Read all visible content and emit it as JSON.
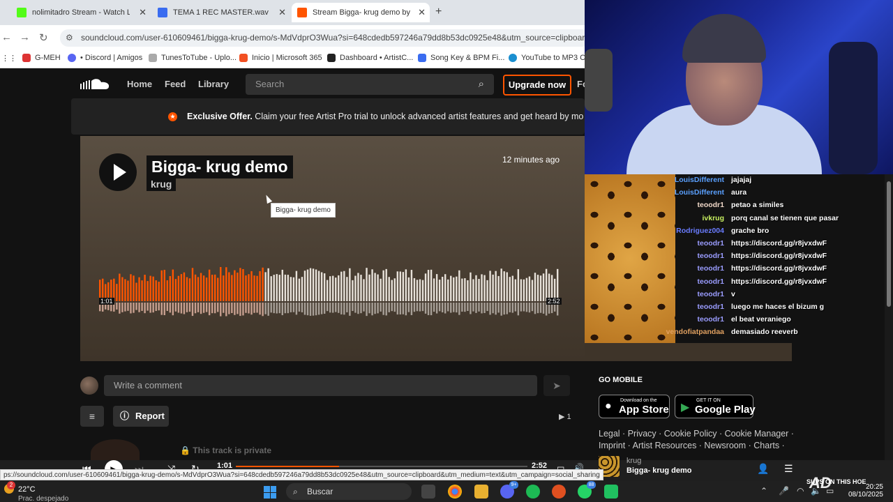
{
  "browser": {
    "tabs": [
      {
        "title": "nolimitadro Stream - Watch Liv",
        "color": "#53fc18"
      },
      {
        "title": "TEMA 1 REC MASTER.wav",
        "color": "#3a6cf0"
      },
      {
        "title": "Stream Bigga- krug demo by k",
        "color": "#ff5500"
      }
    ],
    "url": "soundcloud.com/user-610609461/bigga-krug-demo/s-MdVdprO3Wua?si=648cdedb597246a79dd8b53dc0925e48&utm_source=clipboard",
    "bookmarks": [
      {
        "label": "G-MEH",
        "color": "#d33"
      },
      {
        "label": "• Discord | Amigos",
        "color": "#5865f2"
      },
      {
        "label": "TunesToTube - Uplo...",
        "color": "#aaa"
      },
      {
        "label": "Inicio | Microsoft 365",
        "color": "#f25022"
      },
      {
        "label": "Dashboard • ArtistC...",
        "color": "#222"
      },
      {
        "label": "Song Key & BPM Fi...",
        "color": "#3a6cf0"
      },
      {
        "label": "YouTube to MP3 Co",
        "color": "#1a8fd0"
      }
    ]
  },
  "header": {
    "nav": [
      "Home",
      "Feed",
      "Library"
    ],
    "search_placeholder": "Search",
    "upgrade_label": "Upgrade now",
    "cut_link": "Fo"
  },
  "offer": {
    "bold": "Exclusive Offer.",
    "text": " Claim your free Artist Pro trial to unlock advanced artist features and get heard by mo"
  },
  "track": {
    "title": "Bigga- krug demo",
    "artist": "krug",
    "uploaded": "12 minutes ago",
    "tooltip": "Bigga- krug demo",
    "current_time": "1:01",
    "duration": "2:52",
    "played_fraction": 0.355
  },
  "comments": {
    "placeholder": "Write a comment",
    "report_label": "Report",
    "plays": "1",
    "private_notice": "This track is private"
  },
  "sidebar": {
    "go_mobile": "GO MOBILE",
    "app_store_small": "Download on the",
    "app_store_big": "App Store",
    "google_small": "GET IT ON",
    "google_big": "Google Play",
    "footer_line1": "Legal · Privacy · Cookie Policy · Cookie Manager ·",
    "footer_line2": "Imprint · Artist Resources · Newsroom · Charts ·"
  },
  "player": {
    "time_current": "1:01",
    "time_total": "2:52",
    "now_playing_artist": "krug",
    "now_playing_title": "Bigga- krug demo"
  },
  "status_url": "ps://soundcloud.com/user-610609461/bigga-krug-demo/s-MdVdprO3Wua?si=648cdedb597246a79dd8b53dc0925e48&utm_source=clipboard&utm_medium=text&utm_campaign=social_sharing",
  "taskbar": {
    "temp": "22°C",
    "weather": "Prac. despejado",
    "weather_badge": "2",
    "search": "Buscar",
    "badge_discord": "9+",
    "badge_whatsapp": "88",
    "time": "20:25",
    "date": "08/10/2025"
  },
  "chat": [
    {
      "user": "LouisDifferent",
      "msg": "jajajaj",
      "color": "#5aa0ff"
    },
    {
      "user": "LouisDifferent",
      "msg": "aura",
      "color": "#5aa0ff"
    },
    {
      "user": "teoodr1",
      "msg": "petao a similes",
      "color": "#f0d8c8"
    },
    {
      "user": "ivkrug",
      "msg": "porq canal se tienen que pasar",
      "color": "#c8f060"
    },
    {
      "user": "Rodriguez004",
      "msg": "grache bro",
      "color": "#6a7cff"
    },
    {
      "user": "teoodr1",
      "msg": "https://discord.gg/r8jvxdwF",
      "color": "#9a9cff"
    },
    {
      "user": "teoodr1",
      "msg": "https://discord.gg/r8jvxdwF",
      "color": "#9a9cff"
    },
    {
      "user": "teoodr1",
      "msg": "https://discord.gg/r8jvxdwF",
      "color": "#9a9cff"
    },
    {
      "user": "teoodr1",
      "msg": "https://discord.gg/r8jvxdwF",
      "color": "#9a9cff"
    },
    {
      "user": "teoodr1",
      "msg": "v",
      "color": "#9a9cff"
    },
    {
      "user": "teoodr1",
      "msg": "luego me haces el bizum g",
      "color": "#9a9cff"
    },
    {
      "user": "teoodr1",
      "msg": "el beat veraniego",
      "color": "#9a9cff"
    },
    {
      "user": "vendofiatpandaa",
      "msg": "demasiado reeverb",
      "color": "#e0a060"
    }
  ],
  "overlay": {
    "logo": "AD",
    "sub": "SUPS ON THIS HOE"
  },
  "colors": {
    "accent": "#ff5500"
  }
}
